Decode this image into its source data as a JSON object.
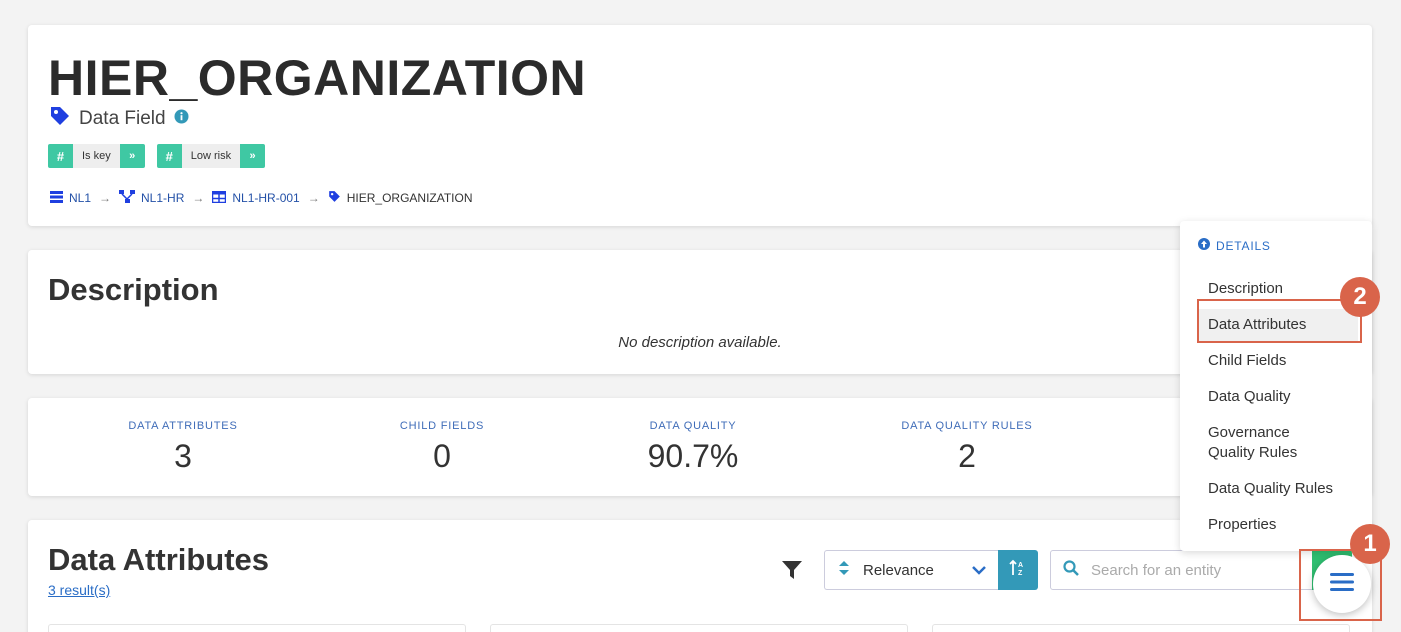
{
  "header": {
    "title": "HIER_ORGANIZATION",
    "type_label": "Data Field",
    "tags": [
      {
        "hash": "#",
        "label": "Is key",
        "more": "»"
      },
      {
        "hash": "#",
        "label": "Low risk",
        "more": "»"
      }
    ],
    "breadcrumb": [
      {
        "label": "NL1",
        "icon": "database-icon"
      },
      {
        "label": "NL1-HR",
        "icon": "schema-icon"
      },
      {
        "label": "NL1-HR-001",
        "icon": "table-icon"
      },
      {
        "label": "HIER_ORGANIZATION",
        "icon": "tag-icon"
      }
    ],
    "arrow": "→"
  },
  "description": {
    "title": "Description",
    "empty_text": "No description available."
  },
  "stats": [
    {
      "label": "DATA ATTRIBUTES",
      "value": "3"
    },
    {
      "label": "CHILD FIELDS",
      "value": "0"
    },
    {
      "label": "DATA QUALITY",
      "value": "90.7%"
    },
    {
      "label": "DATA QUALITY RULES",
      "value": "2"
    }
  ],
  "data_attributes": {
    "title": "Data Attributes",
    "results": "3 result(s)",
    "sort_value": "Relevance",
    "search_placeholder": "Search for an entity"
  },
  "details_menu": {
    "header": "DETAILS",
    "items": [
      {
        "label": "Description"
      },
      {
        "label": "Data Attributes"
      },
      {
        "label": "Child Fields"
      },
      {
        "label": "Data Quality"
      },
      {
        "label": "Governance\nQuality Rules"
      },
      {
        "label": "Data Quality Rules"
      },
      {
        "label": "Properties"
      }
    ]
  },
  "annotations": {
    "badge_1": "1",
    "badge_2": "2"
  },
  "colors": {
    "tag_green": "#3fc8a3",
    "link_blue": "#2451a7",
    "sort_blue": "#3399b8",
    "annotation_red": "#d9644a",
    "tag_icon_blue": "#1f3fe0"
  }
}
